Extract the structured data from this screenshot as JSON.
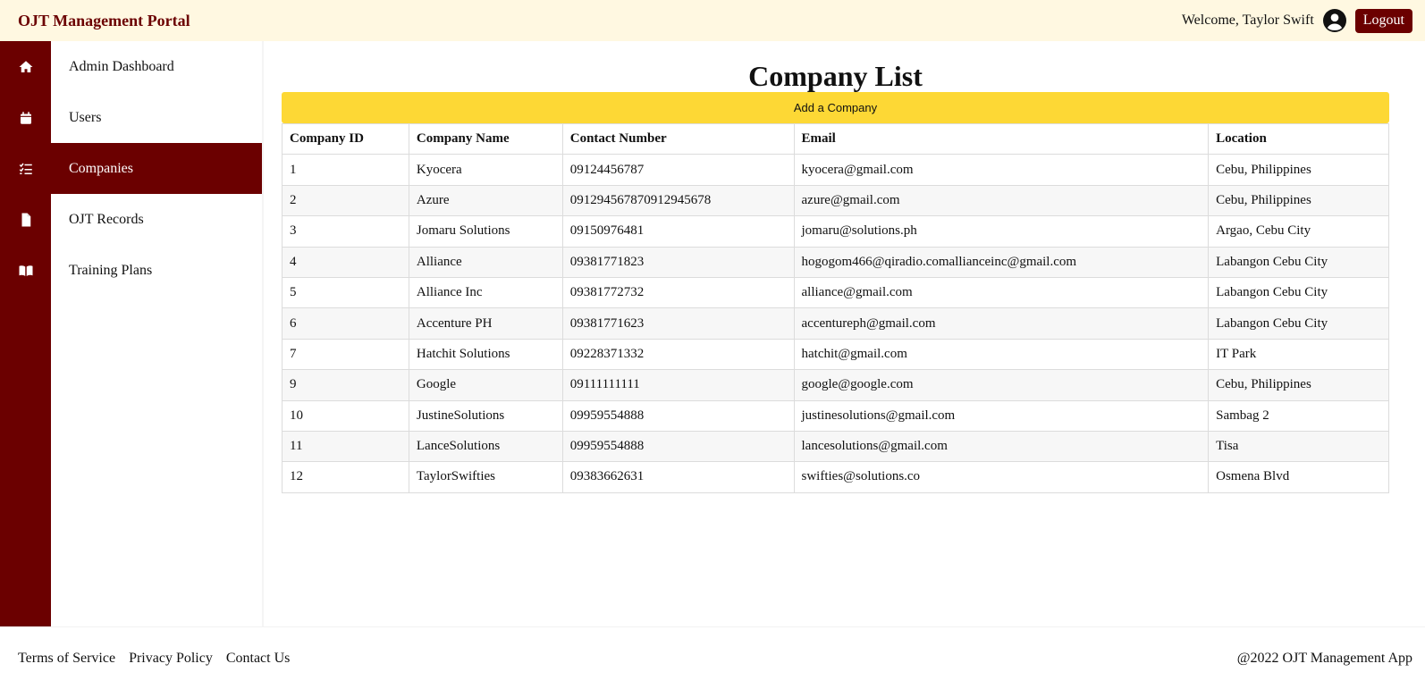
{
  "header": {
    "brand": "OJT Management Portal",
    "welcome": "Welcome, Taylor Swift",
    "logout_label": "Logout"
  },
  "rail_icons": [
    "home-icon",
    "calendar-icon",
    "checklist-icon",
    "document-icon",
    "book-icon"
  ],
  "sidebar": {
    "items": [
      {
        "label": "Admin Dashboard",
        "active": false
      },
      {
        "label": "Users",
        "active": false
      },
      {
        "label": "Companies",
        "active": true
      },
      {
        "label": "OJT Records",
        "active": false
      },
      {
        "label": "Training Plans",
        "active": false
      }
    ]
  },
  "main": {
    "title": "Company List",
    "add_label": "Add a Company",
    "columns": [
      "Company ID",
      "Company Name",
      "Contact Number",
      "Email",
      "Location"
    ],
    "rows": [
      [
        "1",
        "Kyocera",
        "09124456787",
        "kyocera@gmail.com",
        "Cebu, Philippines"
      ],
      [
        "2",
        "Azure",
        "091294567870912945678",
        "azure@gmail.com",
        "Cebu, Philippines"
      ],
      [
        "3",
        "Jomaru Solutions",
        "09150976481",
        "jomaru@solutions.ph",
        "Argao, Cebu City"
      ],
      [
        "4",
        "Alliance",
        "09381771823",
        "hogogom466@qiradio.comallianceinc@gmail.com",
        "Labangon Cebu City"
      ],
      [
        "5",
        "Alliance Inc",
        "09381772732",
        "alliance@gmail.com",
        "Labangon Cebu City"
      ],
      [
        "6",
        "Accenture PH",
        "09381771623",
        "accentureph@gmail.com",
        "Labangon Cebu City"
      ],
      [
        "7",
        "Hatchit Solutions",
        "09228371332",
        "hatchit@gmail.com",
        "IT Park"
      ],
      [
        "9",
        "Google",
        "09111111111",
        "google@google.com",
        "Cebu, Philippines"
      ],
      [
        "10",
        "JustineSolutions",
        "09959554888",
        "justinesolutions@gmail.com",
        "Sambag 2"
      ],
      [
        "11",
        "LanceSolutions",
        "09959554888",
        "lancesolutions@gmail.com",
        "Tisa"
      ],
      [
        "12",
        "TaylorSwifties",
        "09383662631",
        "swifties@solutions.co",
        "Osmena Blvd"
      ]
    ]
  },
  "footer": {
    "links": [
      "Terms of Service",
      "Privacy Policy",
      "Contact Us"
    ],
    "copyright": "@2022 OJT Management App"
  },
  "colors": {
    "brand": "#6b0000",
    "header_bg": "#fff8e1",
    "add_button": "#fdd835"
  }
}
